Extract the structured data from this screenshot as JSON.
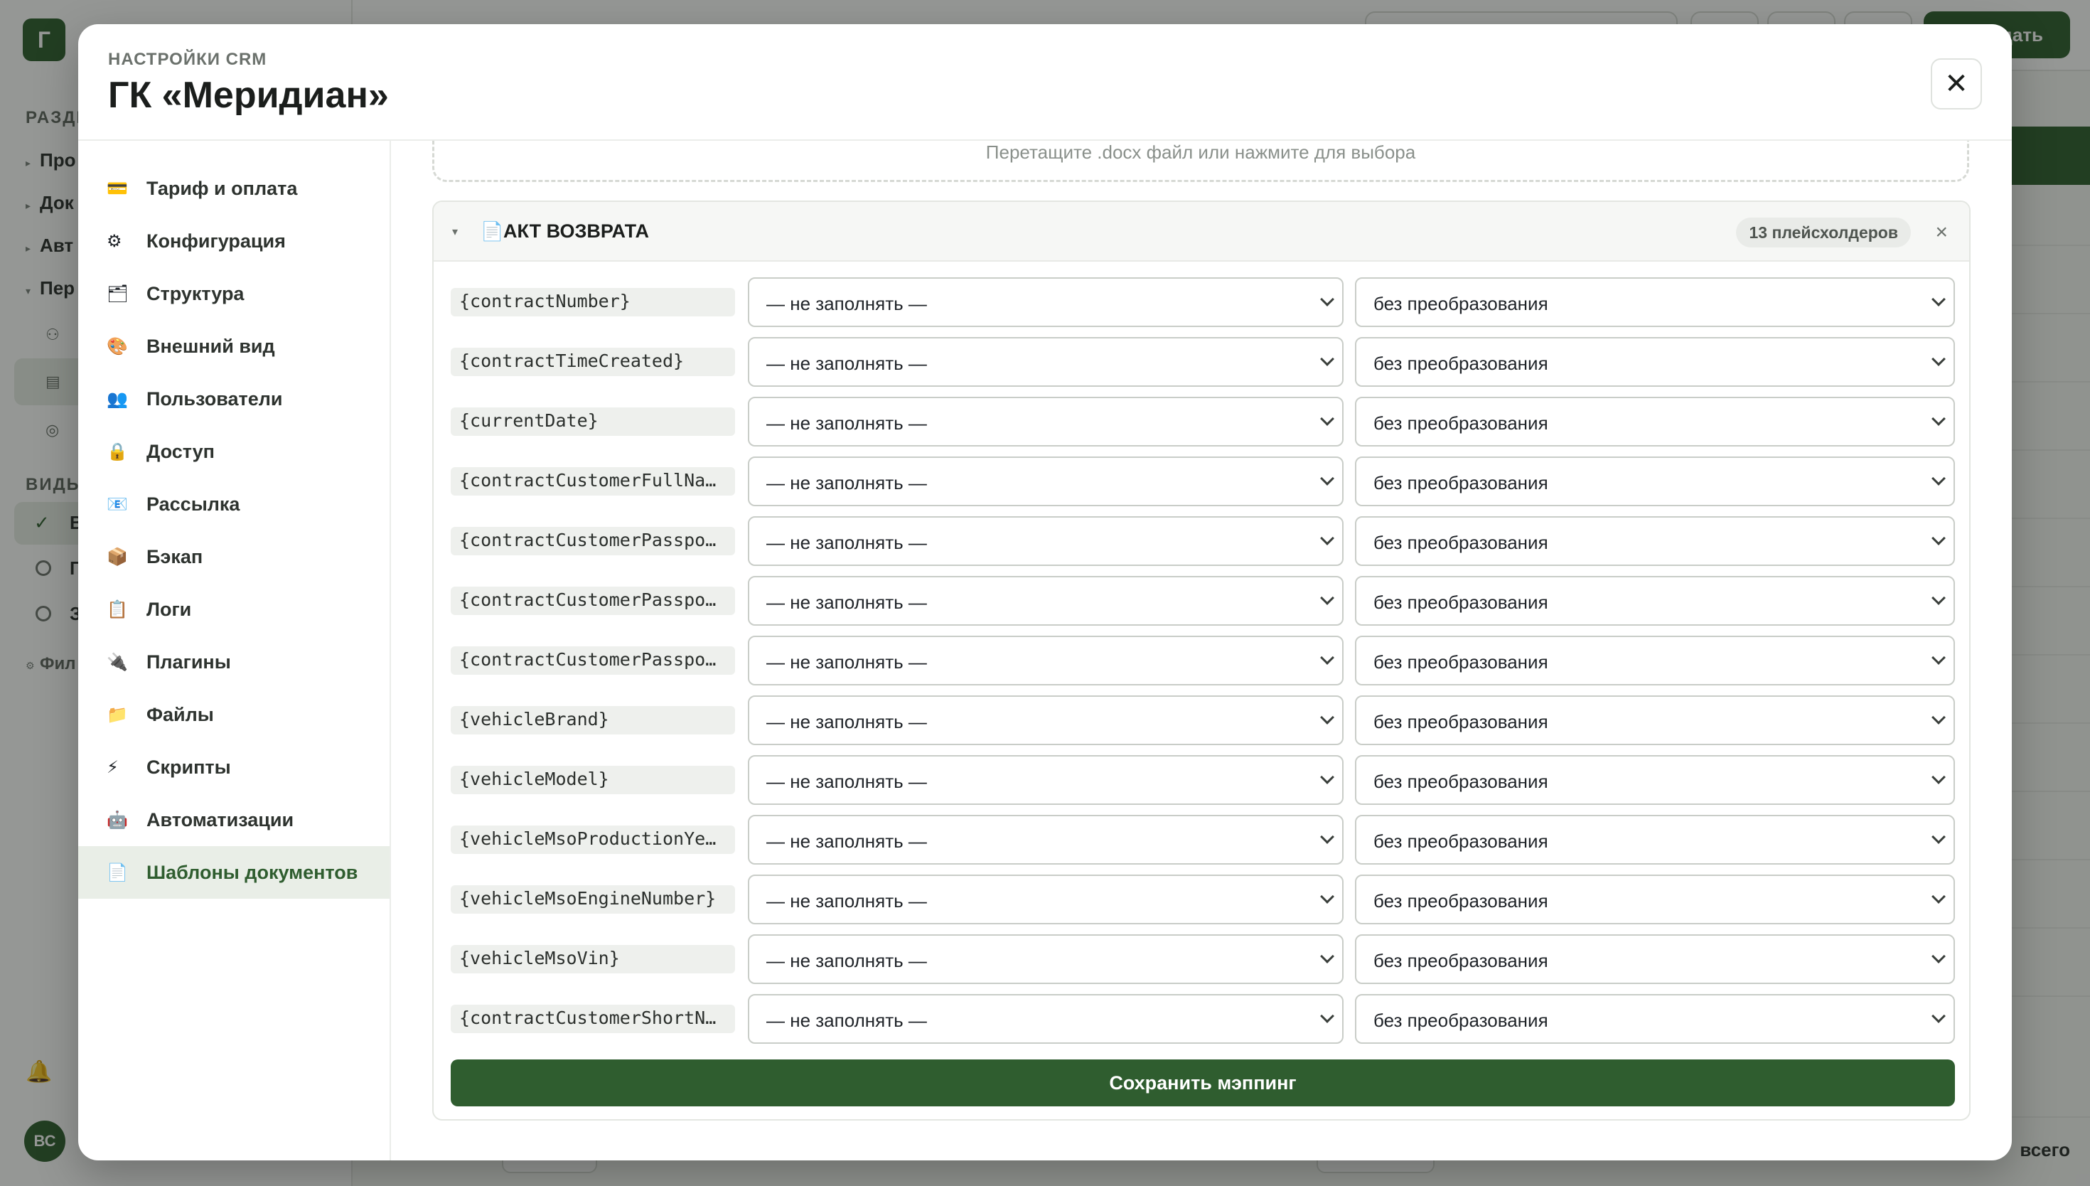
{
  "background": {
    "logo_letter": "Г",
    "sections_label": "РАЗДЕ",
    "nav": [
      "Про",
      "Док",
      "Авт",
      "Пер"
    ],
    "views_label": "ВИДЫ",
    "views": [
      "В",
      "Г",
      "З"
    ],
    "filter_label": "Фил",
    "create_button": "дать",
    "footer_total": "всего",
    "avatar": "ВС"
  },
  "modal": {
    "eyebrow": "НАСТРОЙКИ CRM",
    "title": "ГК «Меридиан»",
    "close_symbol": "✕"
  },
  "nav": [
    {
      "icon": "💳",
      "icon_name": "credit-card-icon",
      "label": "Тариф и оплата"
    },
    {
      "icon": "⚙",
      "icon_name": "gear-icon",
      "label": "Конфигурация"
    },
    {
      "icon": "🗂",
      "icon_name": "folders-icon",
      "label": "Структура"
    },
    {
      "icon": "🎨",
      "icon_name": "palette-icon",
      "label": "Внешний вид"
    },
    {
      "icon": "👥",
      "icon_name": "users-icon",
      "label": "Пользователи"
    },
    {
      "icon": "🔒",
      "icon_name": "lock-icon",
      "label": "Доступ"
    },
    {
      "icon": "📧",
      "icon_name": "mail-icon",
      "label": "Рассылка"
    },
    {
      "icon": "📦",
      "icon_name": "package-icon",
      "label": "Бэкап"
    },
    {
      "icon": "📋",
      "icon_name": "clipboard-icon",
      "label": "Логи"
    },
    {
      "icon": "🔌",
      "icon_name": "plug-icon",
      "label": "Плагины"
    },
    {
      "icon": "📁",
      "icon_name": "folder-icon",
      "label": "Файлы"
    },
    {
      "icon": "⚡",
      "icon_name": "lightning-icon",
      "label": "Скрипты"
    },
    {
      "icon": "🤖",
      "icon_name": "robot-icon",
      "label": "Автоматизации"
    },
    {
      "icon": "📄",
      "icon_name": "document-icon",
      "label": "Шаблоны документов",
      "active": true
    }
  ],
  "dropzone_text": "Перетащите .docx файл или нажмите для выбора",
  "template": {
    "doc_icon": "📄",
    "title": "АКТ ВОЗВРАТА",
    "badge": "13 плейсхолдеров",
    "caret": "▾",
    "close": "×",
    "rows": [
      {
        "key": "{contractNumber}",
        "source": "— не заполнять —",
        "transform": "без преобразования"
      },
      {
        "key": "{contractTimeCreated}",
        "source": "— не заполнять —",
        "transform": "без преобразования"
      },
      {
        "key": "{currentDate}",
        "source": "— не заполнять —",
        "transform": "без преобразования"
      },
      {
        "key": "{contractCustomerFullName}",
        "source": "— не заполнять —",
        "transform": "без преобразования"
      },
      {
        "key": "{contractCustomerPassport…",
        "source": "— не заполнять —",
        "transform": "без преобразования"
      },
      {
        "key": "{contractCustomerPassport…",
        "source": "— не заполнять —",
        "transform": "без преобразования"
      },
      {
        "key": "{contractCustomerPassport…",
        "source": "— не заполнять —",
        "transform": "без преобразования"
      },
      {
        "key": "{vehicleBrand}",
        "source": "— не заполнять —",
        "transform": "без преобразования"
      },
      {
        "key": "{vehicleModel}",
        "source": "— не заполнять —",
        "transform": "без преобразования"
      },
      {
        "key": "{vehicleMsoProductionYear}",
        "source": "— не заполнять —",
        "transform": "без преобразования"
      },
      {
        "key": "{vehicleMsoEngineNumber}",
        "source": "— не заполнять —",
        "transform": "без преобразования"
      },
      {
        "key": "{vehicleMsoVin}",
        "source": "— не заполнять —",
        "transform": "без преобразования"
      },
      {
        "key": "{contractCustomerShortNam…",
        "source": "— не заполнять —",
        "transform": "без преобразования"
      }
    ],
    "save_label": "Сохранить мэппинг"
  },
  "colors": {
    "accent": "#2f5d2f",
    "overlay": "rgba(20,24,21,0.45)"
  }
}
